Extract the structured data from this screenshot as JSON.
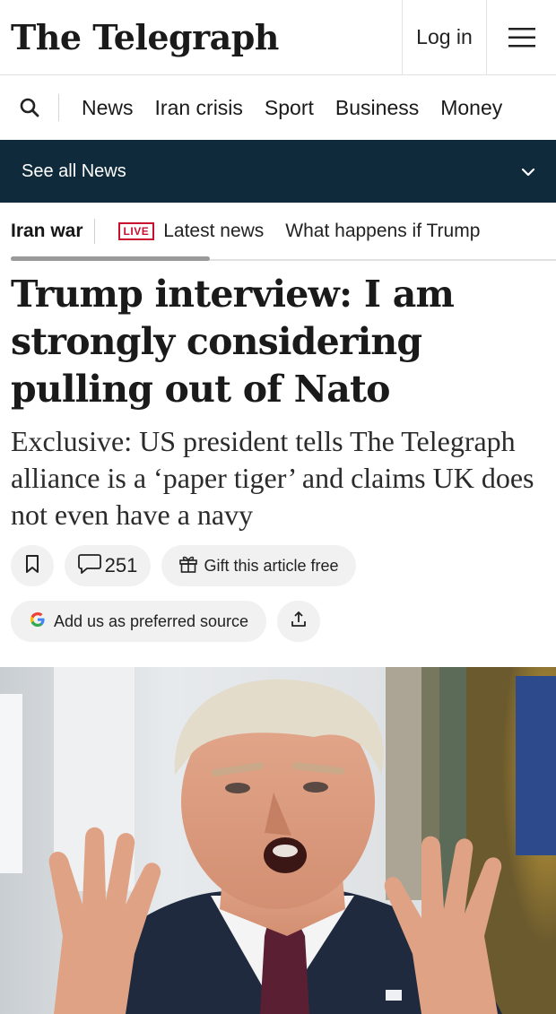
{
  "header": {
    "logo_text": "The Telegraph",
    "login_label": "Log in",
    "menu_icon": "hamburger-menu-icon"
  },
  "nav": {
    "search_icon": "search-icon",
    "items": [
      "News",
      "Iran crisis",
      "Sport",
      "Business",
      "Money"
    ]
  },
  "section_bar": {
    "label": "See all News",
    "icon": "chevron-down-icon",
    "background": "#0f2a3a"
  },
  "topics": {
    "main": "Iran war",
    "live_badge": "LIVE",
    "latest": "Latest news",
    "second": "What happens if Trump"
  },
  "article": {
    "headline": "Trump interview: I am strongly considering pulling out of Nato",
    "standfirst": "Exclusive: US president tells The Telegraph alliance is a ‘paper tiger’ and claims UK does not even have a navy",
    "comment_count": "251",
    "gift_label": "Gift this article free",
    "preferred_source_label": "Add us as preferred source",
    "bookmark_icon": "bookmark-icon",
    "comment_icon": "comment-icon",
    "gift_icon": "gift-icon",
    "google_icon": "google-g-icon",
    "share_icon": "share-icon"
  },
  "colors": {
    "live_red": "#c8102e",
    "section_navy": "#0f2a3a",
    "pill_bg": "#f1f1f1"
  }
}
